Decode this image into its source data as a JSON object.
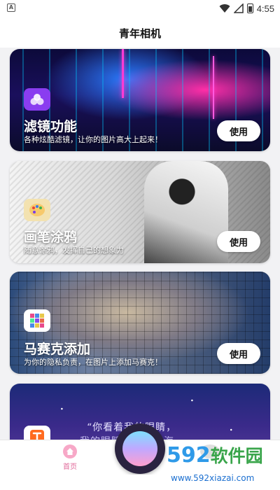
{
  "status_bar": {
    "app_badge": "A",
    "time": "4:55",
    "icons": [
      "wifi-icon",
      "signal-icon",
      "battery-icon"
    ]
  },
  "header": {
    "title": "青年相机"
  },
  "cards": [
    {
      "title": "滤镜功能",
      "description": "各种炫酷滤镜，让你的图片高大上起来！",
      "button": "使用",
      "icon": "filter-icon",
      "icon_color": "#8a3df0"
    },
    {
      "title": "画笔涂鸦",
      "description": "随意涂鸦，发挥自己的想象力",
      "button": "使用",
      "icon": "palette-icon",
      "icon_color": "#f3e2b0"
    },
    {
      "title": "马赛克添加",
      "description": "为你的隐私负责，在图片上添加马赛克！",
      "button": "使用",
      "icon": "mosaic-icon",
      "icon_color": "#ffffff"
    },
    {
      "quote_line1": "“你看着我的眼睛，",
      "quote_line2": "我的眼睛是星辰大海",
      "icon": "text-icon",
      "icon_color": "#ff6a1f"
    }
  ],
  "bottom_nav": {
    "home_label": "首页",
    "accent": "#e06a9a"
  },
  "watermark": {
    "logo_num": "592",
    "logo_cn": "软件园",
    "url": "www.592xiazai.com"
  }
}
